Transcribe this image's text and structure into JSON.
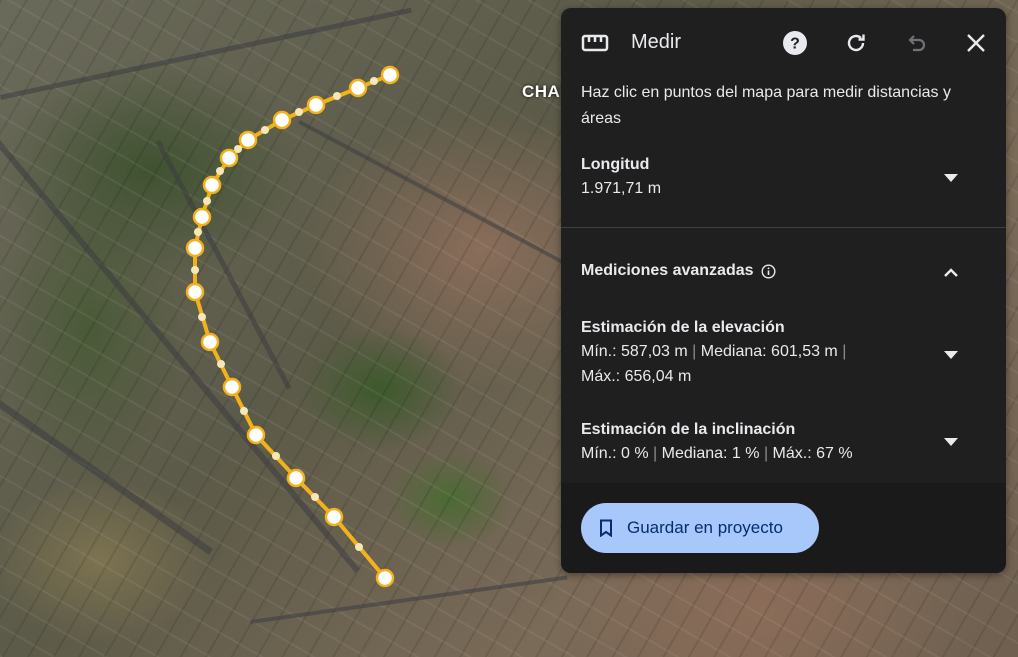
{
  "map": {
    "label": "CHA",
    "route_points_count_note": "",
    "route_color": "#f2b21c"
  },
  "panel": {
    "title": "Medir",
    "icons": {
      "tool": "ruler-icon",
      "help": "help-icon",
      "reset": "refresh-icon",
      "undo": "undo-icon",
      "close": "close-icon"
    },
    "description": "Haz clic en puntos del mapa para medir distancias y áreas",
    "length": {
      "label": "Longitud",
      "value": "1.971,71 m"
    },
    "advanced": {
      "label": "Mediciones avanzadas",
      "info_icon": "info-icon"
    },
    "elevation": {
      "label": "Estimación de la elevación",
      "min": "Mín.: 587,03 m",
      "median": "Mediana: 601,53 m",
      "max": "Máx.: 656,04 m"
    },
    "slope": {
      "label": "Estimación de la inclinación",
      "min": "Mín.: 0 %",
      "median": "Mediana: 1 %",
      "max": "Máx.: 67 %"
    },
    "save_button": "Guardar en proyecto",
    "accent_color": "#a8c7fa"
  }
}
